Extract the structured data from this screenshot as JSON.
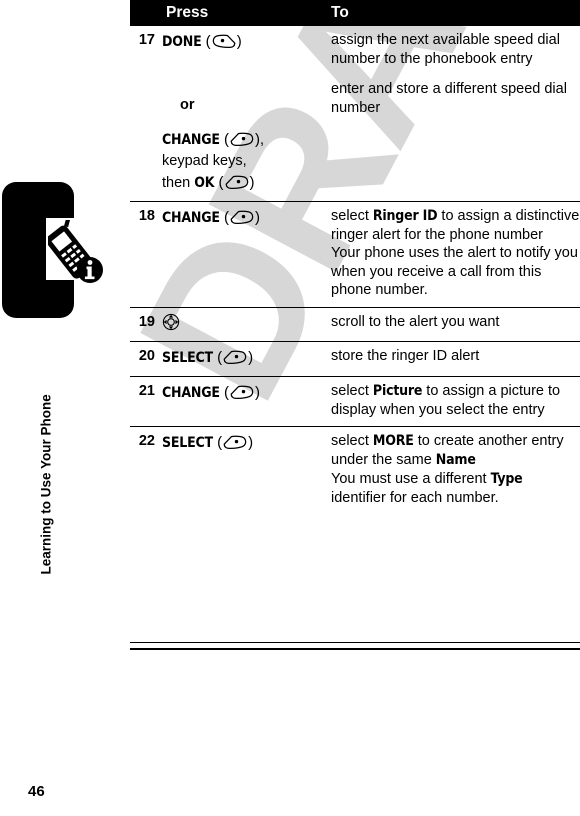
{
  "document": {
    "watermark": "DRAFT",
    "running_head": "Learning to Use Your Phone",
    "page_number": "46",
    "sidebar_icon": "mobile-phone-info-icon"
  },
  "table": {
    "headers": {
      "num": "",
      "press": "Press",
      "to": "To"
    },
    "rows": [
      {
        "num": "17",
        "press_parts": [
          {
            "type": "disp",
            "text": "DONE"
          },
          {
            "type": "key",
            "icon": "right-soft-key"
          }
        ],
        "to_paragraphs": [
          [
            {
              "type": "plain",
              "text": "assign the next available speed dial number to the phonebook entry"
            }
          ]
        ],
        "rule_above": false
      },
      {
        "num": "",
        "or_label": "or",
        "press_parts": [
          {
            "type": "disp",
            "text": "CHANGE"
          },
          {
            "type": "key",
            "icon": "left-soft-key"
          },
          {
            "type": "plain",
            "text": ","
          },
          {
            "type": "break"
          },
          {
            "type": "plain",
            "text": "keypad keys,"
          },
          {
            "type": "break"
          },
          {
            "type": "plain",
            "text": "then "
          },
          {
            "type": "disp",
            "text": "OK"
          },
          {
            "type": "key",
            "icon": "left-soft-key"
          }
        ],
        "to_paragraphs": [
          [
            {
              "type": "plain",
              "text": "enter and store a different speed dial number"
            }
          ]
        ],
        "rule_above": false
      },
      {
        "num": "18",
        "press_parts": [
          {
            "type": "disp",
            "text": "CHANGE"
          },
          {
            "type": "key",
            "icon": "left-soft-key"
          }
        ],
        "to_paragraphs": [
          [
            {
              "type": "plain",
              "text": "select "
            },
            {
              "type": "disp",
              "text": "Ringer ID"
            },
            {
              "type": "plain",
              "text": " to assign a distinctive ringer alert for the phone number"
            }
          ],
          [
            {
              "type": "plain",
              "text": "Your phone uses the alert to notify you when you receive a call from this phone number."
            }
          ]
        ],
        "rule_above": true
      },
      {
        "num": "19",
        "press_parts": [
          {
            "type": "navkey",
            "icon": "navigation-key"
          }
        ],
        "to_paragraphs": [
          [
            {
              "type": "plain",
              "text": "scroll to the alert you want"
            }
          ]
        ],
        "rule_above": true
      },
      {
        "num": "20",
        "press_parts": [
          {
            "type": "disp",
            "text": "SELECT"
          },
          {
            "type": "key",
            "icon": "left-soft-key"
          }
        ],
        "to_paragraphs": [
          [
            {
              "type": "plain",
              "text": "store the ringer ID alert"
            }
          ]
        ],
        "rule_above": true
      },
      {
        "num": "21",
        "press_parts": [
          {
            "type": "disp",
            "text": "CHANGE"
          },
          {
            "type": "key",
            "icon": "left-soft-key"
          }
        ],
        "to_paragraphs": [
          [
            {
              "type": "plain",
              "text": "select "
            },
            {
              "type": "disp",
              "text": "Picture"
            },
            {
              "type": "plain",
              "text": " to assign a picture to display when you select the entry"
            }
          ]
        ],
        "rule_above": true
      },
      {
        "num": "22",
        "press_parts": [
          {
            "type": "disp",
            "text": "SELECT"
          },
          {
            "type": "key",
            "icon": "left-soft-key"
          }
        ],
        "to_paragraphs": [
          [
            {
              "type": "plain",
              "text": "select "
            },
            {
              "type": "disp",
              "text": "MORE"
            },
            {
              "type": "plain",
              "text": " to create another entry under the same "
            },
            {
              "type": "disp",
              "text": "Name"
            }
          ],
          [
            {
              "type": "plain",
              "text": "You must use a different "
            },
            {
              "type": "disp",
              "text": "Type"
            },
            {
              "type": "plain",
              "text": " identifier for each number."
            }
          ]
        ],
        "rule_above": true
      }
    ]
  },
  "colors": {
    "header_band": "#000000",
    "header_text": "#ffffff",
    "rule": "#000000",
    "watermark": "#d7d7d7",
    "tab": "#000000",
    "body_text": "#000000"
  }
}
